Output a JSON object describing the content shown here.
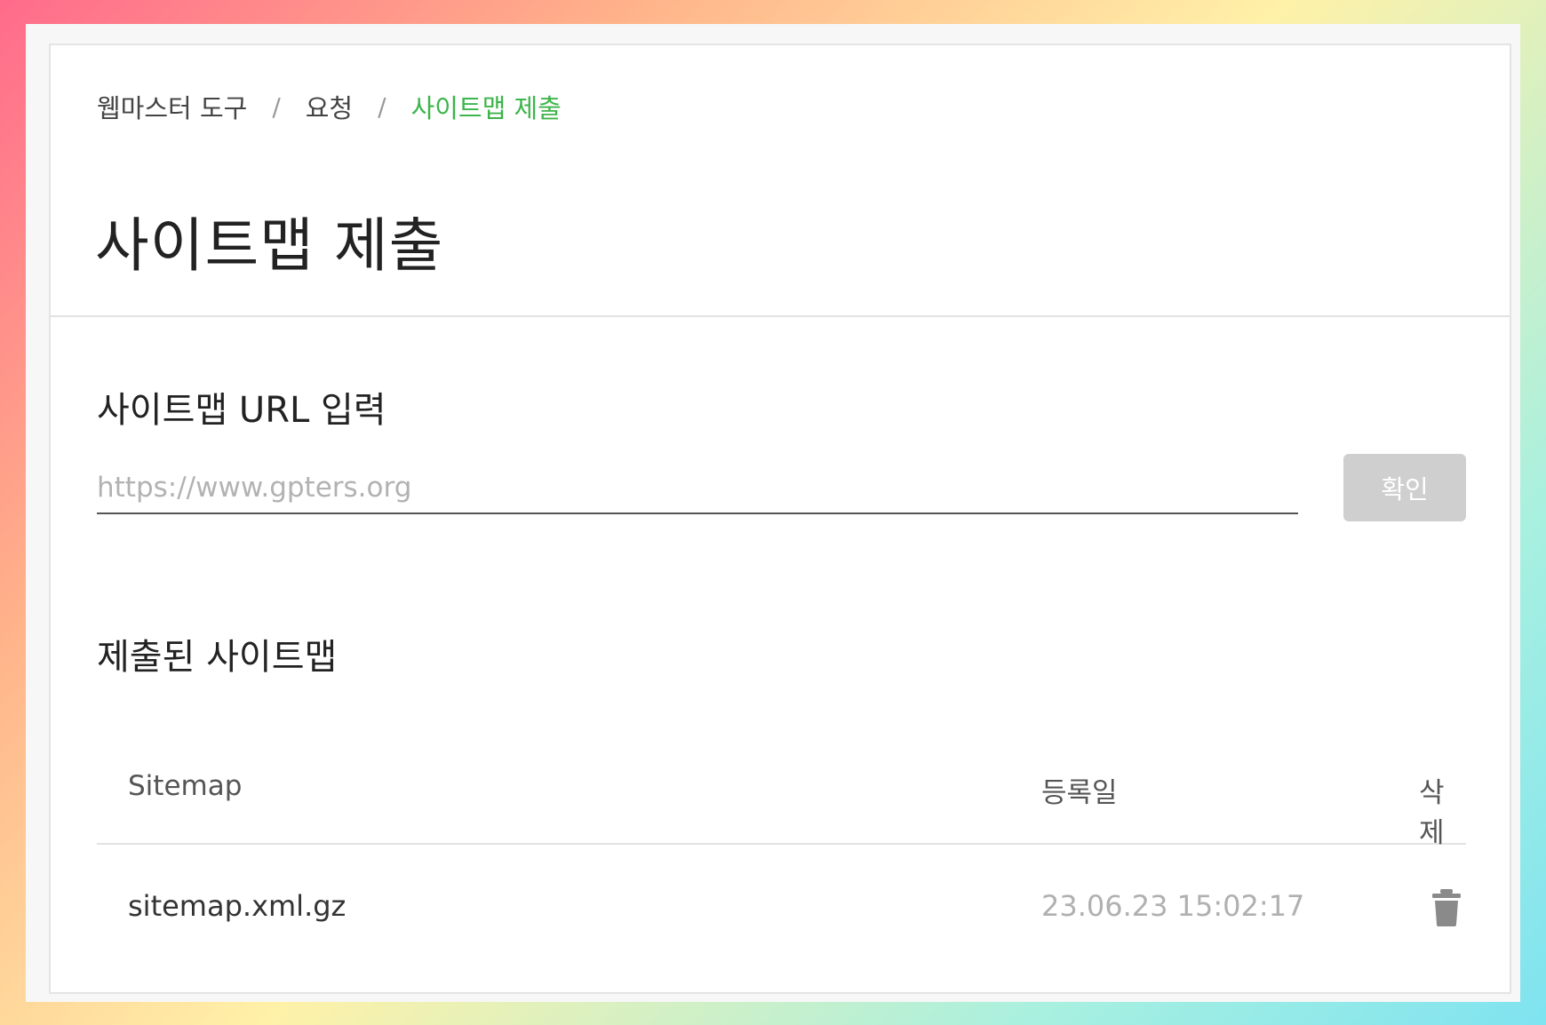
{
  "breadcrumb": {
    "items": [
      "웹마스터 도구",
      "요청"
    ],
    "separator": "/",
    "current": "사이트맵 제출"
  },
  "page": {
    "title": "사이트맵 제출"
  },
  "url_section": {
    "title": "사이트맵 URL 입력",
    "input_value": "",
    "input_placeholder": "https://www.gpters.org",
    "confirm_label": "확인"
  },
  "list_section": {
    "title": "제출된 사이트맵",
    "columns": {
      "sitemap": "Sitemap",
      "date": "등록일",
      "delete": "삭제"
    },
    "rows": [
      {
        "name": "sitemap.xml.gz",
        "date": "23.06.23 15:02:17",
        "delete_icon": "trash-icon"
      }
    ]
  },
  "colors": {
    "accent": "#3cb54a",
    "button_disabled": "#cfcfcf",
    "icon": "#8a8a8a"
  }
}
